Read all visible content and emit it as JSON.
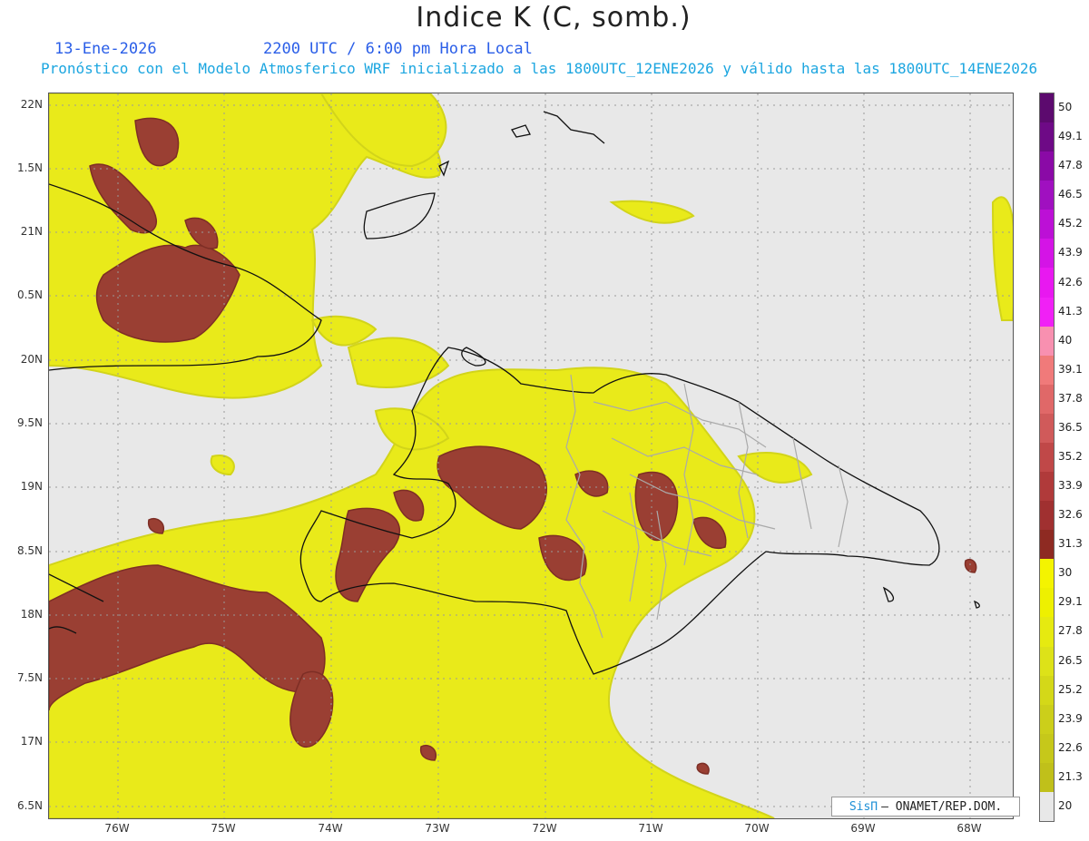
{
  "header": {
    "title": "Indice K (C, somb.)",
    "date": "13-Ene-2026",
    "time": "2200 UTC / 6:00 pm Hora Local",
    "subtitle": "Pronóstico con el Modelo Atmosferico WRF inicializado a las 1800UTC_12ENE2026 y válido hasta las  1800UTC_14ENE2026"
  },
  "map": {
    "lat_labels": [
      "22N",
      "1.5N",
      "21N",
      "0.5N",
      "20N",
      "9.5N",
      "19N",
      "8.5N",
      "18N",
      "7.5N",
      "17N",
      "6.5N"
    ],
    "lon_labels": [
      "76W",
      "75W",
      "74W",
      "73W",
      "72W",
      "71W",
      "70W",
      "69W",
      "68W"
    ],
    "lat_values": [
      22,
      21.5,
      21,
      20.5,
      20,
      19.5,
      19,
      18.5,
      18,
      17.5,
      17,
      16.5
    ],
    "lon_values": [
      -76,
      -75,
      -74,
      -73,
      -72,
      -71,
      -70,
      -69,
      -68
    ]
  },
  "colorbar": {
    "labels": [
      "50",
      "49.1",
      "47.8",
      "46.5",
      "45.2",
      "43.9",
      "42.6",
      "41.3",
      "40",
      "39.1",
      "37.8",
      "36.5",
      "35.2",
      "33.9",
      "32.6",
      "31.3",
      "30",
      "29.1",
      "27.8",
      "26.5",
      "25.2",
      "23.9",
      "22.6",
      "21.3",
      "20"
    ],
    "colors": [
      "#5c0a6e",
      "#6e0a86",
      "#8a0aa6",
      "#a010c0",
      "#bc10d6",
      "#d414e6",
      "#e818f0",
      "#f020f6",
      "#f890b0",
      "#f07a7a",
      "#e06868",
      "#d05a5a",
      "#c04848",
      "#b03a3a",
      "#a03030",
      "#8e2a22",
      "#f4f400",
      "#eef000",
      "#e6ea10",
      "#dde218",
      "#d4d818",
      "#cccf1a",
      "#c6c81a",
      "#c0c01a",
      "#e8e8e8"
    ]
  },
  "credit": {
    "logo": "SisΠ",
    "text": "– ONAMET/REP.DOM."
  }
}
